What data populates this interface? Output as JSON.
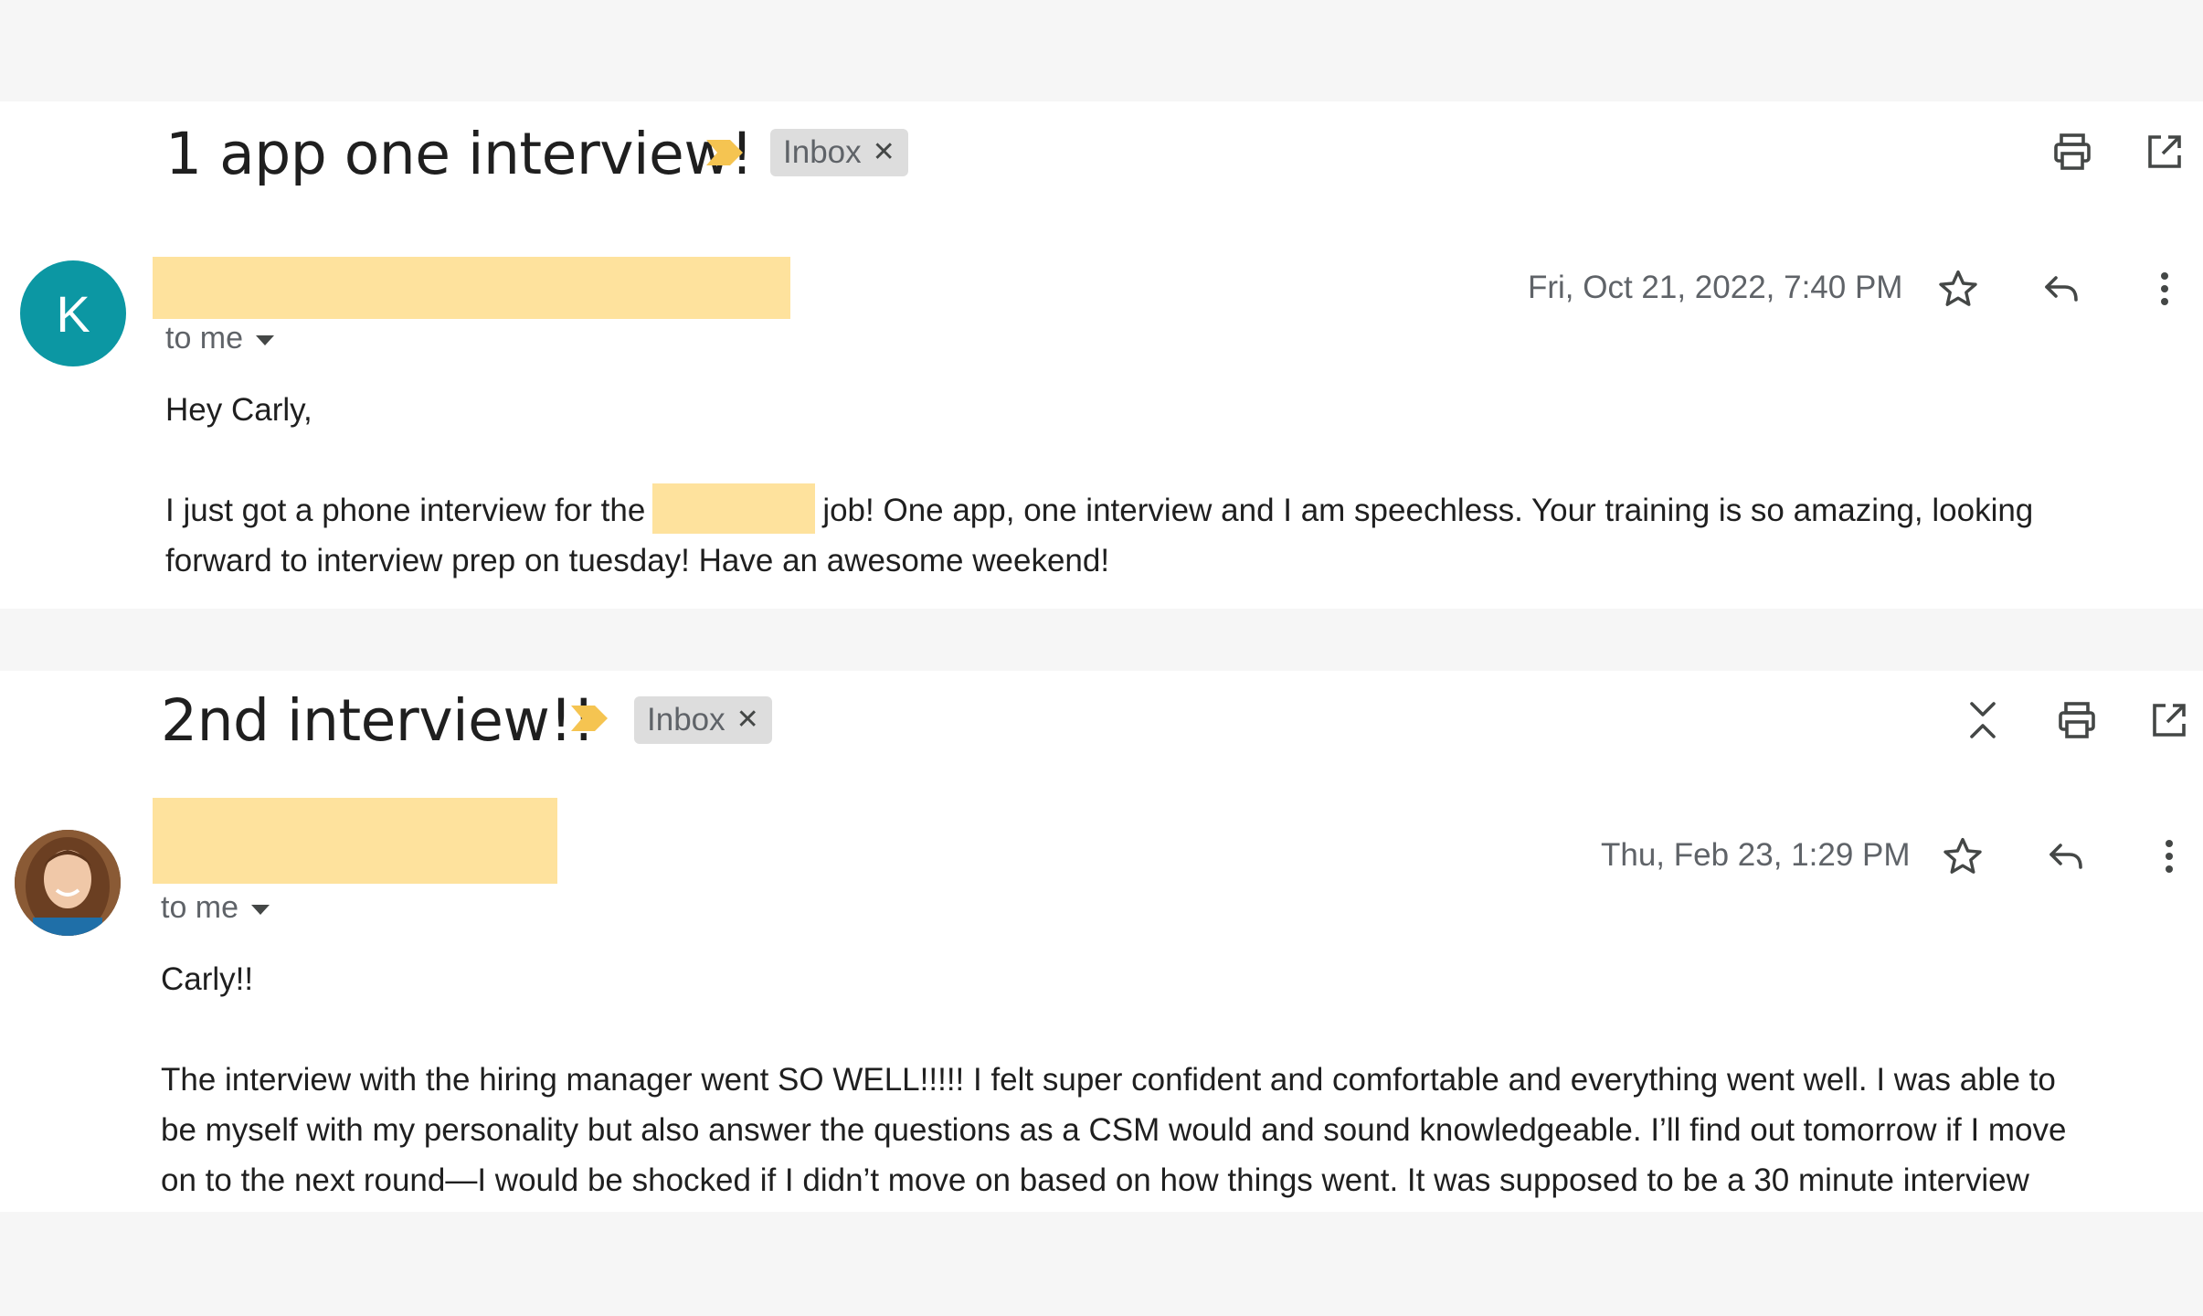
{
  "emails": [
    {
      "subject": "1 app one interview!",
      "label": "Inbox",
      "avatar_letter": "K",
      "recipient": "to me",
      "date": "Fri, Oct 21, 2022, 7:40 PM",
      "body": {
        "greeting": "Hey Carly,",
        "line1_before": "I just got a phone interview for the",
        "line1_after": "job! One app, one interview and I am speechless. Your training is so amazing, looking",
        "line2": "forward to interview prep on tuesday! Have an awesome weekend!"
      }
    },
    {
      "subject": "2nd interview!!",
      "label": "Inbox",
      "recipient": "to me",
      "date": "Thu, Feb 23, 1:29 PM",
      "body": {
        "greeting": "Carly!!",
        "line1": "The interview with the hiring manager went SO WELL!!!!! I felt super confident and comfortable and everything went well. I was able to",
        "line2": "be myself with my personality but also answer the questions as a CSM would and sound knowledgeable. I’ll find out tomorrow if I move",
        "line3": "on to the next round—I would be shocked if I didn’t move on based on how things went. It was supposed to be a 30 minute interview"
      }
    }
  ],
  "icons": {
    "importance": "importance-marker-icon",
    "print": "print-icon",
    "open_new_window": "open-in-new-window-icon",
    "collapse": "collapse-all-icon",
    "star": "star-icon",
    "reply": "reply-icon",
    "more": "more-vertical-icon",
    "label_close": "close-icon"
  },
  "colors": {
    "importance": "#f5c451",
    "avatar_k": "#0c97a3",
    "redaction": "#fee29d",
    "chip": "#dddddd"
  }
}
